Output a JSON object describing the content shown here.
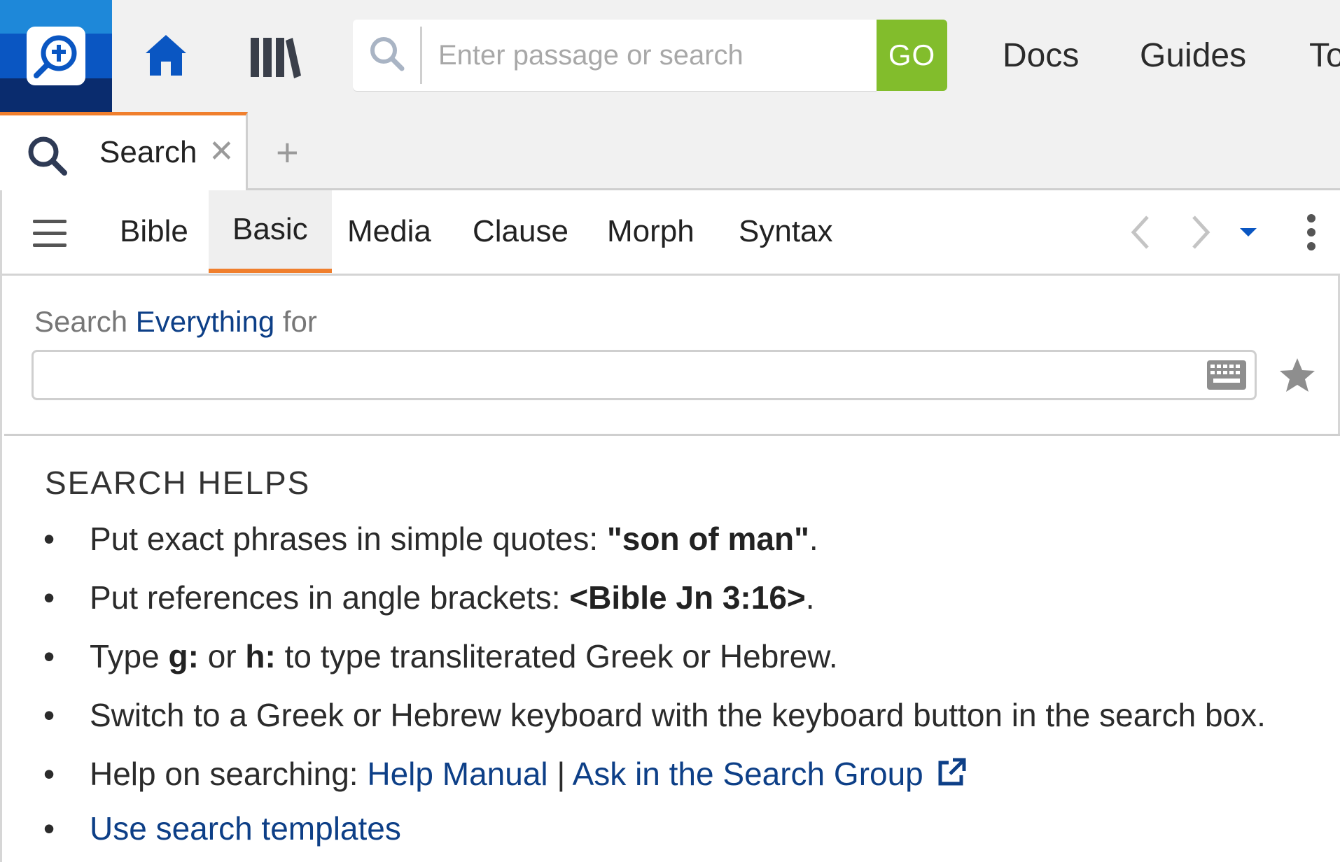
{
  "header": {
    "search_placeholder": "Enter passage or search",
    "go_label": "GO",
    "nav": {
      "docs": "Docs",
      "guides": "Guides",
      "tools": "To"
    }
  },
  "tabs": {
    "active_label": "Search",
    "close_glyph": "✕",
    "new_tab_glyph": "+"
  },
  "toolbar": {
    "modes": [
      "Bible",
      "Basic",
      "Media",
      "Clause",
      "Morph",
      "Syntax"
    ],
    "active_mode": "Basic"
  },
  "search": {
    "prefix": "Search",
    "scope": "Everything",
    "suffix": "for",
    "query_value": ""
  },
  "helps": {
    "title": "SEARCH HELPS",
    "bullet": "•",
    "item1": {
      "text": "Put exact phrases in simple quotes: ",
      "bold": "\"son of man\"",
      "end": "."
    },
    "item2": {
      "text": "Put references in angle brackets: ",
      "bold": "<Bible Jn 3:16>",
      "end": "."
    },
    "item3": {
      "t1": "Type ",
      "b1": "g:",
      "t2": " or ",
      "b2": "h:",
      "t3": " to type transliterated Greek or Hebrew."
    },
    "item4": {
      "text": "Switch to a Greek or Hebrew keyboard with the keyboard button in the search box."
    },
    "item5": {
      "text": "Help on searching: ",
      "link1": "Help Manual",
      "sep": " | ",
      "link2": "Ask in the Search Group"
    },
    "item6": {
      "link": "Use search templates"
    }
  },
  "icons": [
    "logos-logo-icon",
    "home-icon",
    "library-icon",
    "search-icon",
    "close-icon",
    "plus-icon",
    "menu-icon",
    "chevron-left-icon",
    "chevron-right-icon",
    "caret-down-icon",
    "more-vertical-icon",
    "keyboard-icon",
    "star-icon",
    "external-link-icon"
  ],
  "colors": {
    "accent_orange": "#f07f2d",
    "go_green": "#82bd2c",
    "link_blue": "#0d3f87",
    "logo_blue": "#0a56c2"
  }
}
